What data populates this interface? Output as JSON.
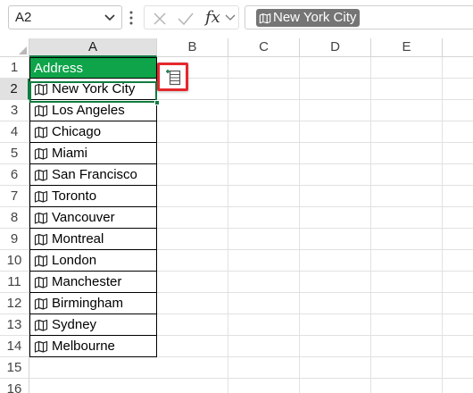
{
  "formula_bar": {
    "name_box": "A2",
    "formula_value": "New York City",
    "cancel_icon": "x-icon",
    "enter_icon": "check-icon",
    "function_label": "fx"
  },
  "columns": [
    "A",
    "B",
    "C",
    "D",
    "E"
  ],
  "rows": [
    "1",
    "2",
    "3",
    "4",
    "5",
    "6",
    "7",
    "8",
    "9",
    "10",
    "11",
    "12",
    "13",
    "14",
    "15",
    "16"
  ],
  "table": {
    "header": "Address",
    "header_color": "#0fa44a",
    "cells": [
      "New York City",
      "Los Angeles",
      "Chicago",
      "Miami",
      "San Francisco",
      "Toronto",
      "Vancouver",
      "Montreal",
      "London",
      "Manchester",
      "Birmingham",
      "Sydney",
      "Melbourne"
    ],
    "cell_icon": "map-icon"
  },
  "selection": {
    "active_cell": "A2",
    "accent_color": "#107c41"
  },
  "insert_data_button": {
    "icon": "insert-data-icon",
    "highlight_color": "#e5282e"
  }
}
